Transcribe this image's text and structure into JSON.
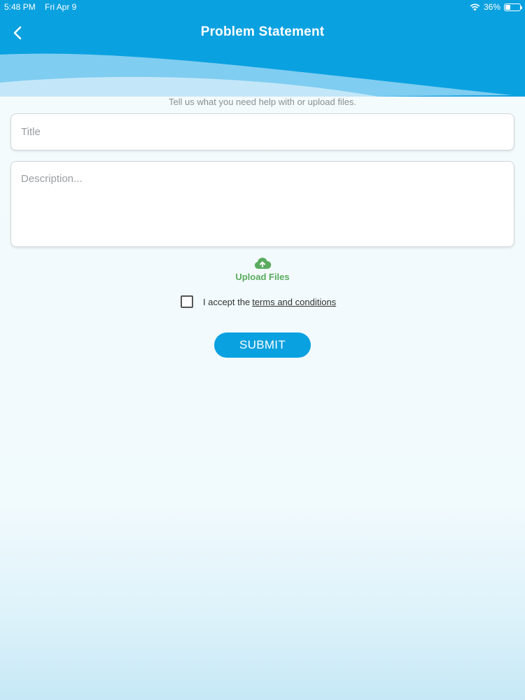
{
  "status_bar": {
    "time": "5:48 PM",
    "date": "Fri Apr 9",
    "battery_text": "36%",
    "battery_level": 0.36,
    "wifi_icon": "wifi-icon"
  },
  "header": {
    "title": "Problem Statement",
    "back_icon": "chevron-left-icon"
  },
  "form": {
    "subtitle": "Tell us what you need help with or upload files.",
    "title_placeholder": "Title",
    "title_value": "",
    "description_placeholder": "Description...",
    "description_value": "",
    "upload_label": "Upload Files",
    "upload_icon": "cloud-upload-icon",
    "terms_prefix": "I accept the",
    "terms_link": "terms and conditions",
    "terms_checked": false,
    "submit_label": "SUBMIT"
  },
  "colors": {
    "header": "#0aa1e0",
    "accent": "#0aa1e0",
    "upload": "#5aab5d"
  }
}
